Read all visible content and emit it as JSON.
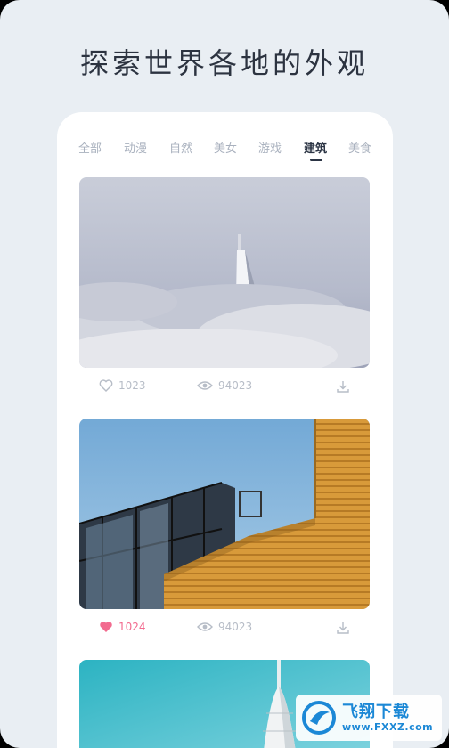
{
  "headline": "探索世界各地的外观",
  "tabs": [
    {
      "label": "全部",
      "active": false
    },
    {
      "label": "动漫",
      "active": false
    },
    {
      "label": "自然",
      "active": false
    },
    {
      "label": "美女",
      "active": false
    },
    {
      "label": "游戏",
      "active": false
    },
    {
      "label": "建筑",
      "active": true
    },
    {
      "label": "美食",
      "active": false
    }
  ],
  "cards": [
    {
      "likes": "1023",
      "views": "94023",
      "liked": false,
      "image": "skyscraper-in-clouds"
    },
    {
      "likes": "1024",
      "views": "94023",
      "liked": true,
      "image": "glass-and-orange-building"
    },
    {
      "image": "tower-blue-sky"
    }
  ],
  "watermark": {
    "title": "飞翔下载",
    "url": "www.FXXZ.com"
  },
  "colors": {
    "background": "#e9eef3",
    "like_active": "#f26b8f",
    "tab_active": "#2b3444",
    "tab_inactive": "#a9b1be"
  }
}
